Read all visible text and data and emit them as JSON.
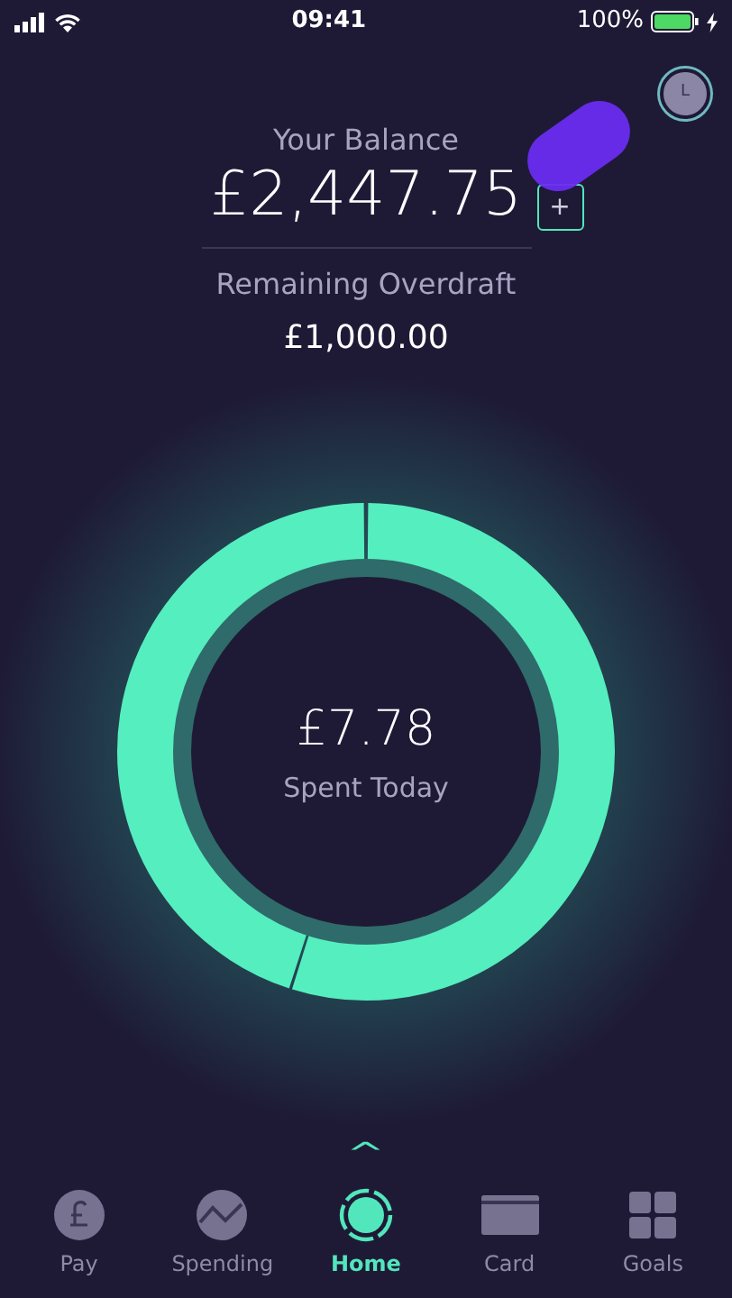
{
  "status_bar": {
    "time": "09:41",
    "battery": "100%"
  },
  "profile": {
    "initial": "L"
  },
  "balance": {
    "label": "Your Balance",
    "amount": "£2,447.75",
    "add_button": "+"
  },
  "overdraft": {
    "label": "Remaining Overdraft",
    "amount": "£1,000.00"
  },
  "spent_today": {
    "amount": "£7.78",
    "label": "Spent Today"
  },
  "expand_handle": "^",
  "tabs": [
    {
      "kind": "pay",
      "label": "Pay",
      "selected": false
    },
    {
      "kind": "spending",
      "label": "Spending",
      "selected": false
    },
    {
      "kind": "home",
      "label": "Home",
      "selected": true
    },
    {
      "kind": "card",
      "label": "Card",
      "selected": false
    },
    {
      "kind": "goals",
      "label": "Goals",
      "selected": false
    }
  ]
}
